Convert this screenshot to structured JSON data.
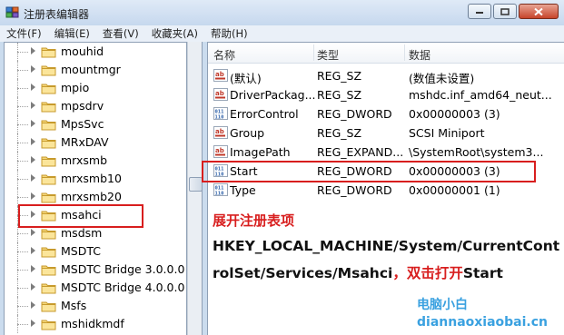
{
  "window": {
    "title": "注册表编辑器",
    "icon": "registry-editor-icon"
  },
  "menu": [
    "文件(F)",
    "编辑(E)",
    "查看(V)",
    "收藏夹(A)",
    "帮助(H)"
  ],
  "tree": {
    "items": [
      {
        "label": "mouhid"
      },
      {
        "label": "mountmgr"
      },
      {
        "label": "mpio"
      },
      {
        "label": "mpsdrv"
      },
      {
        "label": "MpsSvc"
      },
      {
        "label": "MRxDAV"
      },
      {
        "label": "mrxsmb"
      },
      {
        "label": "mrxsmb10"
      },
      {
        "label": "mrxsmb20"
      },
      {
        "label": "msahci"
      },
      {
        "label": "msdsm"
      },
      {
        "label": "MSDTC"
      },
      {
        "label": "MSDTC Bridge 3.0.0.0"
      },
      {
        "label": "MSDTC Bridge 4.0.0.0"
      },
      {
        "label": "Msfs"
      },
      {
        "label": "mshidkmdf"
      }
    ],
    "selected": "msahci"
  },
  "list": {
    "columns": {
      "name": "名称",
      "type": "类型",
      "data": "数据"
    },
    "rows": [
      {
        "icon": "string-value-icon",
        "name": "(默认)",
        "type": "REG_SZ",
        "data": "(数值未设置)"
      },
      {
        "icon": "string-value-icon",
        "name": "DriverPackag...",
        "type": "REG_SZ",
        "data": "mshdc.inf_amd64_neut..."
      },
      {
        "icon": "dword-value-icon",
        "name": "ErrorControl",
        "type": "REG_DWORD",
        "data": "0x00000003 (3)"
      },
      {
        "icon": "string-value-icon",
        "name": "Group",
        "type": "REG_SZ",
        "data": "SCSI Miniport"
      },
      {
        "icon": "string-value-icon",
        "name": "ImagePath",
        "type": "REG_EXPAND...",
        "data": "\\SystemRoot\\system3..."
      },
      {
        "icon": "dword-value-icon",
        "name": "Start",
        "type": "REG_DWORD",
        "data": "0x00000003 (3)"
      },
      {
        "icon": "dword-value-icon",
        "name": "Type",
        "type": "REG_DWORD",
        "data": "0x00000001 (1)"
      }
    ]
  },
  "annotation": {
    "title": "展开注册表项",
    "line1": "HKEY_LOCAL_MACHINE/System/CurrentCont",
    "line2_path": "rolSet/Services/Msahci",
    "line2_mid": "，双击打开",
    "line2_end": "Start",
    "highlight_color": "#d81e1e"
  },
  "watermark": {
    "name": "电脑小白",
    "url": "diannaoxiaobai.cn",
    "color": "#3aa1e0"
  }
}
